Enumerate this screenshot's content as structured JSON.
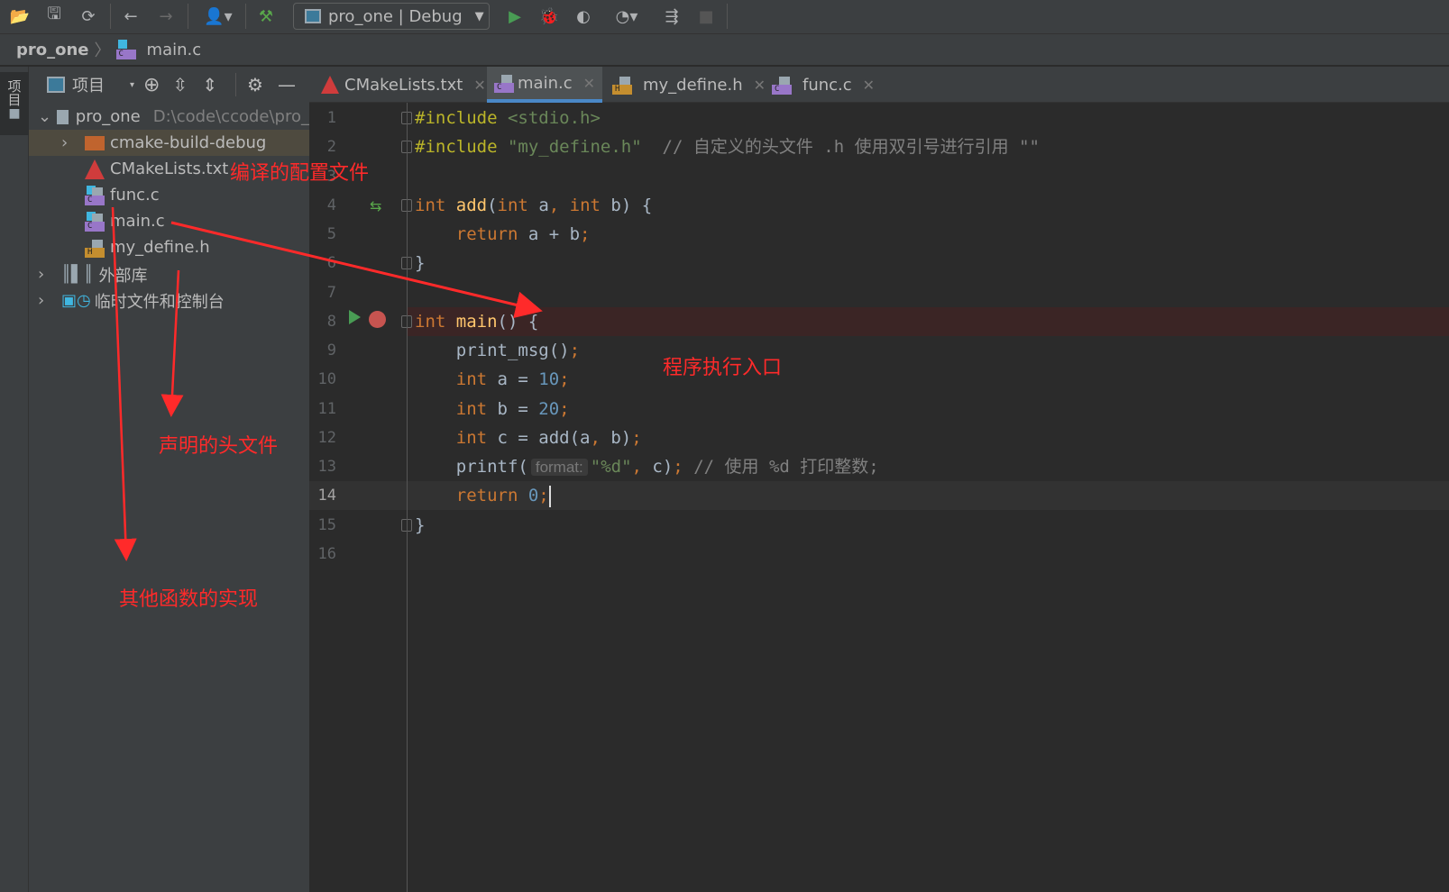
{
  "toolbar": {
    "run_config": "pro_one | Debug",
    "icons": [
      "open-folder-icon",
      "save-icon",
      "sync-icon",
      "back-icon",
      "forward-icon",
      "user-icon",
      "build-hammer-icon",
      "run-icon",
      "debug-icon",
      "coverage-icon",
      "profile-icon",
      "attach-icon",
      "stop-icon"
    ]
  },
  "breadcrumb": {
    "project": "pro_one",
    "file": "main.c"
  },
  "leftstrip": {
    "label": "项目"
  },
  "project_panel": {
    "title": "项目",
    "tree": [
      {
        "label": "pro_one",
        "path": "D:\\code\\ccode\\pro_",
        "type": "folder",
        "expanded": true
      },
      {
        "label": "cmake-build-debug",
        "type": "build-folder",
        "expanded": false
      },
      {
        "label": "CMakeLists.txt",
        "type": "cmake"
      },
      {
        "label": "func.c",
        "type": "c"
      },
      {
        "label": "main.c",
        "type": "c"
      },
      {
        "label": "my_define.h",
        "type": "h"
      },
      {
        "label": "外部库",
        "type": "library"
      },
      {
        "label": "临时文件和控制台",
        "type": "scratch"
      }
    ]
  },
  "tabs": [
    {
      "label": "CMakeLists.txt",
      "type": "cmake",
      "active": false
    },
    {
      "label": "main.c",
      "type": "c",
      "active": true
    },
    {
      "label": "my_define.h",
      "type": "h",
      "active": false
    },
    {
      "label": "func.c",
      "type": "c",
      "active": false
    }
  ],
  "editor": {
    "current_line": 14,
    "breakpoint_line": 8,
    "lines": [
      [
        [
          "#include ",
          "pp"
        ],
        [
          "<stdio.h>",
          "str"
        ]
      ],
      [
        [
          "#include ",
          "pp"
        ],
        [
          "\"my_define.h\"",
          "str"
        ],
        [
          "  // 自定义的头文件 .h 使用双引号进行引用 \"\"",
          "cm"
        ]
      ],
      [],
      [
        [
          "int ",
          "kw"
        ],
        [
          "add",
          "fn"
        ],
        [
          "(",
          "pl"
        ],
        [
          "int ",
          "kw"
        ],
        [
          "a",
          "pl"
        ],
        [
          ", ",
          "kw"
        ],
        [
          "int ",
          "kw"
        ],
        [
          "b) {",
          "pl"
        ]
      ],
      [
        [
          "    return ",
          "kw"
        ],
        [
          "a + b",
          "pl"
        ],
        [
          ";",
          "kw"
        ]
      ],
      [
        [
          "}",
          "pl"
        ]
      ],
      [],
      [
        [
          "int ",
          "kw"
        ],
        [
          "main",
          "fn"
        ],
        [
          "() {",
          "pl"
        ]
      ],
      [
        [
          "    print_msg()",
          "pl"
        ],
        [
          ";",
          "kw"
        ]
      ],
      [
        [
          "    int ",
          "kw"
        ],
        [
          "a = ",
          "pl"
        ],
        [
          "10",
          "num"
        ],
        [
          ";",
          "kw"
        ]
      ],
      [
        [
          "    int ",
          "kw"
        ],
        [
          "b = ",
          "pl"
        ],
        [
          "20",
          "num"
        ],
        [
          ";",
          "kw"
        ]
      ],
      [
        [
          "    int ",
          "kw"
        ],
        [
          "c = add(a",
          "pl"
        ],
        [
          ", ",
          "kw"
        ],
        [
          "b)",
          "pl"
        ],
        [
          ";",
          "kw"
        ]
      ],
      [
        [
          "    printf(",
          "pl"
        ],
        [
          "format:",
          "hint"
        ],
        [
          "\"%d\"",
          "str"
        ],
        [
          ", ",
          "kw"
        ],
        [
          "c)",
          "pl"
        ],
        [
          "; ",
          "kw"
        ],
        [
          "// 使用 %d 打印整数;",
          "cm"
        ]
      ],
      [
        [
          "    return ",
          "kw"
        ],
        [
          "0",
          "num"
        ],
        [
          ";",
          "kw"
        ]
      ],
      [
        [
          "}",
          "pl"
        ]
      ],
      []
    ]
  },
  "annotations": {
    "config": "编译的配置文件",
    "entry": "程序执行入口",
    "header": "声明的头文件",
    "impl": "其他函数的实现"
  },
  "colors": {
    "annotation": "#ff2a2a",
    "tab_underline": "#4a88c7",
    "keyword": "#cc7832",
    "function": "#ffc66d",
    "string": "#6a8759",
    "number": "#6897bb"
  }
}
